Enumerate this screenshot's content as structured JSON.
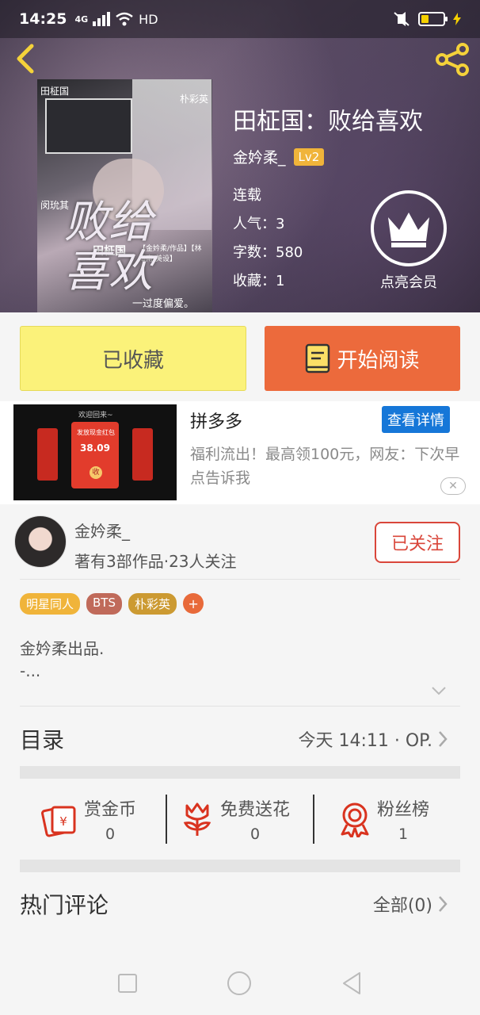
{
  "status_bar": {
    "time": "14:25",
    "network": "4G",
    "hd": "HD"
  },
  "book": {
    "title": "田柾国：败给喜欢",
    "author": "金妗柔_",
    "level": "Lv2",
    "status": "连载",
    "popularity": "人气：3",
    "word_count": "字数：580",
    "collections": "收藏：1",
    "cover_text": {
      "main": "败给喜欢",
      "name1": "田柾国",
      "name2": "朴彩英",
      "name3": "闵玧其",
      "series": "田柾国",
      "tagline": "一过度偏爱。",
      "box": "【金妗柔/作品】【林知南/美设】"
    }
  },
  "vip": {
    "label": "点亮会员"
  },
  "actions": {
    "collected": "已收藏",
    "start_reading": "开始阅读"
  },
  "ad": {
    "title": "拼多多",
    "detail_button": "查看详情",
    "description": "福利流出！最高领100元，网友：下次早点告诉我",
    "close": "✕",
    "image_text": {
      "header": "欢迎回来~",
      "sub": "发放现金红包",
      "amount": "38.09",
      "button": "收"
    }
  },
  "author_panel": {
    "name": "金妗柔_",
    "stats": "著有3部作品·23人关注",
    "follow_button": "已关注"
  },
  "tags": [
    {
      "label": "明星同人",
      "color": "#f0b43a"
    },
    {
      "label": "BTS",
      "color": "#c06a5a"
    },
    {
      "label": "朴彩英",
      "color": "#cc9a32"
    }
  ],
  "tag_add": "+",
  "description": {
    "line1": "金妗柔出品.",
    "line2": "-..."
  },
  "catalog": {
    "title": "目录",
    "latest": "今天 14:11 · OP."
  },
  "stats": [
    {
      "label": "赏金币",
      "value": "0",
      "icon": "red-envelope-icon"
    },
    {
      "label": "免费送花",
      "value": "0",
      "icon": "flower-icon"
    },
    {
      "label": "粉丝榜",
      "value": "1",
      "icon": "medal-icon"
    }
  ],
  "comments": {
    "title": "热门评论",
    "all": "全部(0)"
  },
  "colors": {
    "accent_orange": "#ec6a3c",
    "collected_yellow": "#fbf27a",
    "follow_red": "#d9463a",
    "link_blue": "#1677d8"
  }
}
